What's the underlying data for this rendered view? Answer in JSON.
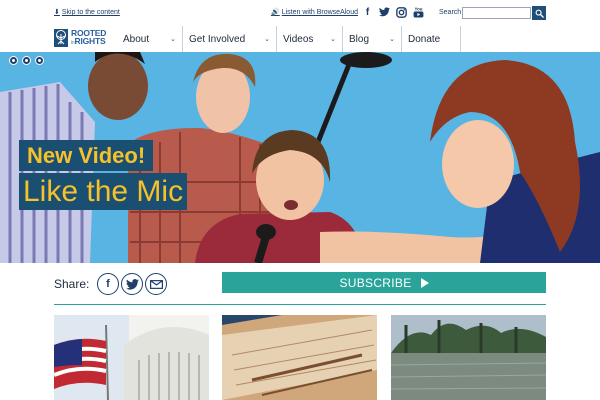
{
  "utility": {
    "skip_link": "Skip to the content",
    "listen_link": "Listen with BrowseAloud",
    "social_icons": [
      "facebook-icon",
      "twitter-icon",
      "instagram-icon",
      "youtube-icon"
    ],
    "youtube_text": "You",
    "search_label": "Search",
    "search_value": "",
    "search_placeholder": ""
  },
  "logo": {
    "line1": "ROOTED",
    "line2": "in",
    "line3": "RIGHTS"
  },
  "nav": {
    "items": [
      {
        "label": "About",
        "has_dropdown": true
      },
      {
        "label": "Get Involved",
        "has_dropdown": true
      },
      {
        "label": "Videos",
        "has_dropdown": true
      },
      {
        "label": "Blog",
        "has_dropdown": true
      },
      {
        "label": "Donate",
        "has_dropdown": false
      }
    ]
  },
  "hero": {
    "eyebrow": "New Video!",
    "title": "Like the Mic",
    "slide_count": 3,
    "colors": {
      "background": "#58b4e3",
      "banner": "#1b4f72",
      "banner_text": "#f6c12a"
    }
  },
  "share": {
    "label": "Share:",
    "icons": [
      "facebook-icon",
      "twitter-icon",
      "email-icon"
    ]
  },
  "subscribe": {
    "label": "SUBSCRIBE",
    "color": "#2aa49a"
  },
  "thumbnails": [
    {
      "subject": "flag-and-capitol"
    },
    {
      "subject": "marriage-license"
    },
    {
      "subject": "flooded-street"
    }
  ]
}
